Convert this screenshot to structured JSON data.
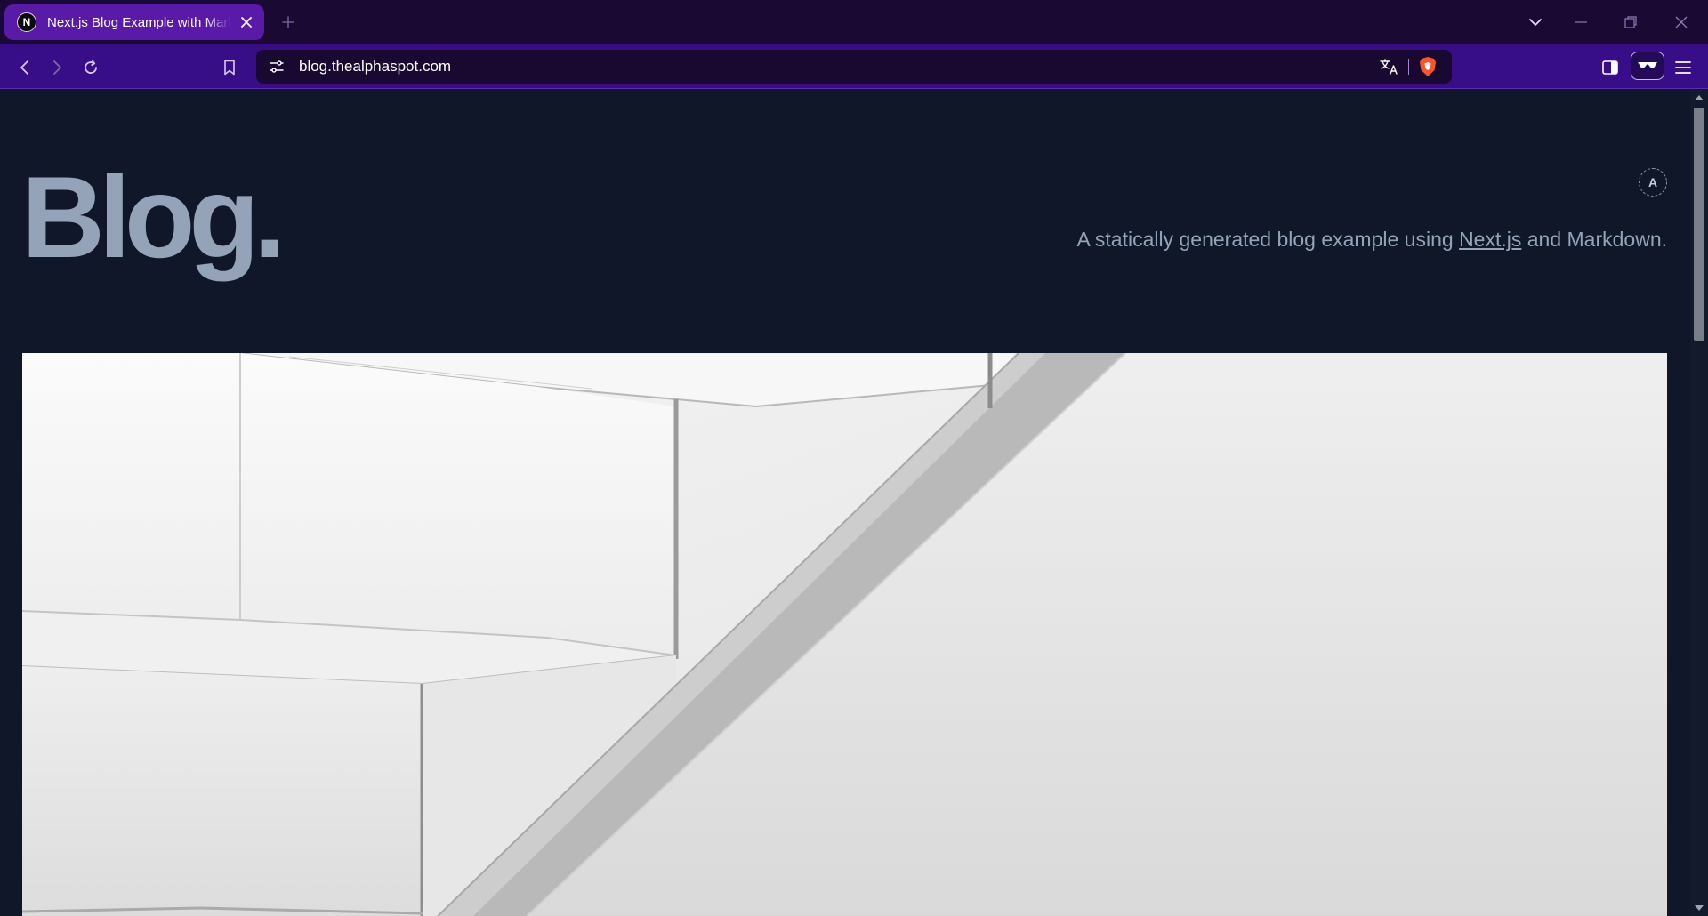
{
  "browser": {
    "tab": {
      "title": "Next.js Blog Example with Markdown",
      "favicon_letter": "N"
    },
    "address_bar": {
      "url": "blog.thealphaspot.com"
    },
    "colors": {
      "tabstrip": "#1a0933",
      "active_tab": "#5a1aa8",
      "toolbar": "#380d88",
      "omnibox": "#19082f",
      "brave_shield": "#fb542b"
    }
  },
  "page": {
    "avatar_letter": "A",
    "title": "Blog.",
    "description": {
      "prefix": "A statically generated blog example using ",
      "link_text": "Next.js",
      "suffix": " and Markdown."
    },
    "cover_image": {
      "description": "Grayscale abstract architectural photo of a white staircase"
    },
    "colors": {
      "background": "#0f1729",
      "text": "#94a3b8"
    }
  }
}
